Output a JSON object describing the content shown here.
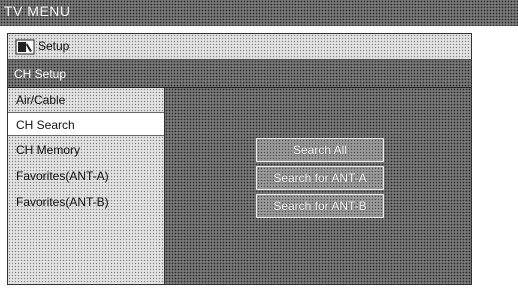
{
  "header": {
    "title": "TV MENU"
  },
  "panel": {
    "setup_label": "Setup",
    "setup_icon": "setup-wrench-icon",
    "section_title": "CH Setup"
  },
  "sidebar": {
    "items": [
      {
        "label": "Air/Cable",
        "selected": false
      },
      {
        "label": "CH Search",
        "selected": true
      },
      {
        "label": "CH Memory",
        "selected": false
      },
      {
        "label": "Favorites(ANT-A)",
        "selected": false
      },
      {
        "label": "Favorites(ANT-B)",
        "selected": false
      }
    ]
  },
  "actions": {
    "search_all": "Search All",
    "search_ant_a": "Search for ANT-A",
    "search_ant_b": "Search for ANT-B"
  }
}
